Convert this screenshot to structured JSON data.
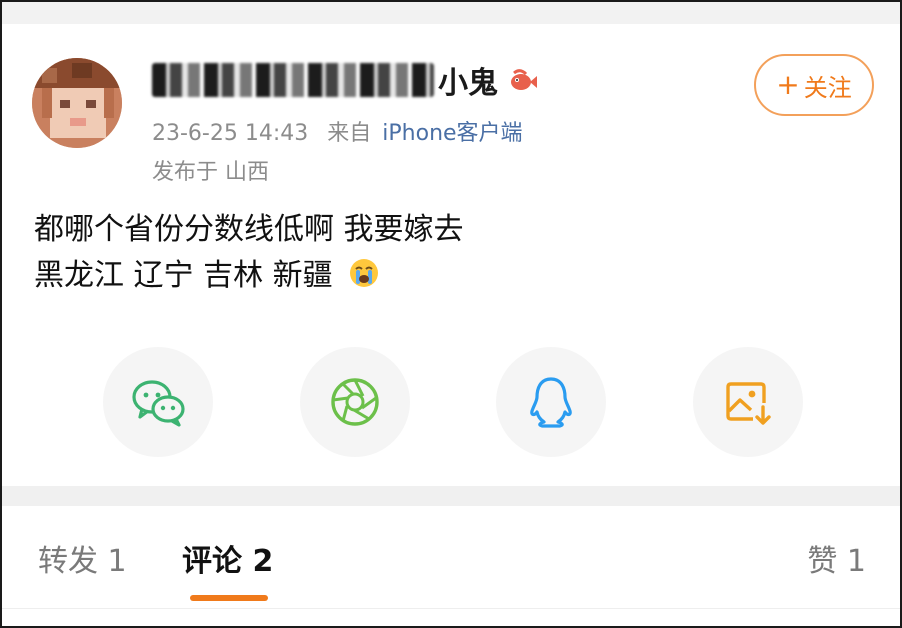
{
  "post": {
    "author": {
      "name_visible_suffix": "小鬼"
    },
    "time": "23-6-25 14:43",
    "source_prefix": "来自",
    "source_app": "iPhone客户端",
    "location": "发布于 山西",
    "follow_label": "关注",
    "follow_plus": "+",
    "text_line1": "都哪个省份分数线低啊 我要嫁去",
    "text_line2": "黑龙江 辽宁 吉林 新疆",
    "emoji": "crying-face"
  },
  "share": [
    {
      "name": "wechat",
      "icon": "wechat-icon",
      "color": "#3cb371"
    },
    {
      "name": "moments",
      "icon": "moments-icon",
      "color": "#6cc04a"
    },
    {
      "name": "qq",
      "icon": "qq-icon",
      "color": "#2a9cf0"
    },
    {
      "name": "save-image",
      "icon": "save-image-icon",
      "color": "#f0a020"
    }
  ],
  "tabs": {
    "repost": "转发 1",
    "comment": "评论 2",
    "like": "赞 1"
  },
  "colors": {
    "accent": "#f07a1b",
    "meta_gray": "#8c8c8c",
    "source_blue": "#4a6fa5"
  }
}
